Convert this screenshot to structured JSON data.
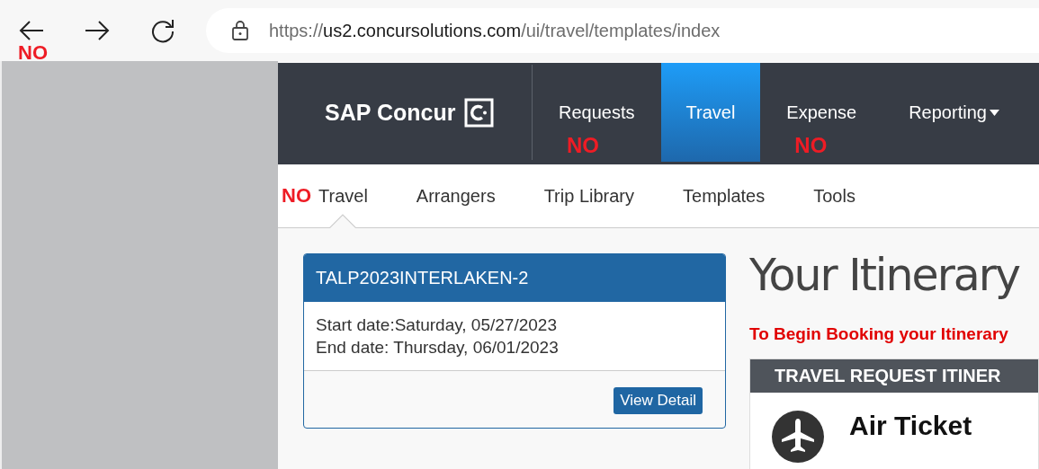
{
  "browser": {
    "url_scheme": "https://",
    "url_host": "us2.concursolutions.com",
    "url_path": "/ui/travel/templates/index",
    "back_annotation": "NO"
  },
  "app_nav": {
    "logo": "SAP Concur",
    "tabs": [
      {
        "label": "Requests",
        "selected": false,
        "annotation": "NO"
      },
      {
        "label": "Travel",
        "selected": true
      },
      {
        "label": "Expense",
        "selected": false,
        "annotation": "NO"
      },
      {
        "label": "Reporting",
        "selected": false,
        "dropdown": true
      }
    ]
  },
  "sub_nav": {
    "tabs": [
      {
        "label": "Travel",
        "selected": true,
        "annotation": "NO"
      },
      {
        "label": "Arrangers",
        "selected": false
      },
      {
        "label": "Trip Library",
        "selected": false
      },
      {
        "label": "Templates",
        "selected": false
      },
      {
        "label": "Tools",
        "selected": false
      }
    ]
  },
  "trip_card": {
    "title": "TALP2023INTERLAKEN-2",
    "start": "Start date:Saturday, 05/27/2023",
    "end": "End date: Thursday, 06/01/2023",
    "button": "View Detail"
  },
  "itinerary": {
    "heading": "Your Itinerary",
    "notice": "To Begin Booking your Itinerary",
    "panel_title": "TRAVEL REQUEST ITINER",
    "item": "Air Ticket"
  }
}
